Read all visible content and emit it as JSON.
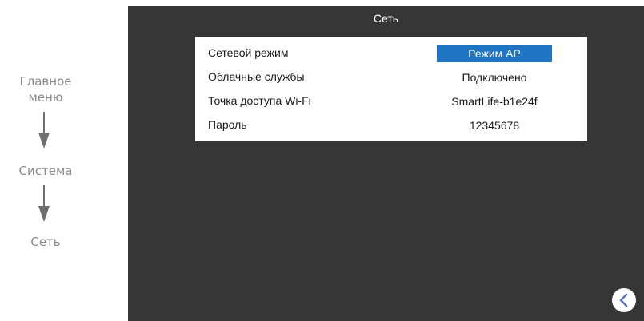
{
  "path": {
    "step1": "Главное меню",
    "step2": "Система",
    "step3": "Сеть"
  },
  "screen": {
    "title": "Сеть",
    "rows": [
      {
        "label": "Сетевой режим",
        "value": "Режим AP"
      },
      {
        "label": "Облачные службы",
        "value": "Подключено"
      },
      {
        "label": "Точка доступа Wi-Fi",
        "value": "SmartLife-b1e24f"
      },
      {
        "label": "Пароль",
        "value": "12345678"
      }
    ]
  },
  "icons": {
    "back": "chevron-left-icon"
  },
  "colors": {
    "screen_bg": "#363636",
    "selected_bg": "#1f74c4",
    "path_text": "#8a8a8a"
  }
}
